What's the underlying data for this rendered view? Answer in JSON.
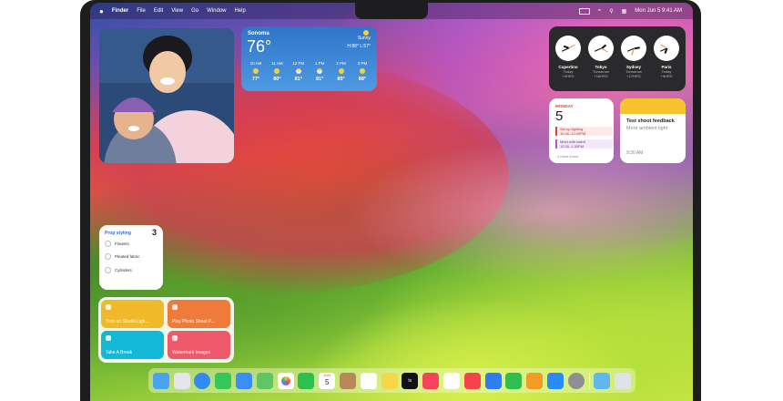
{
  "menubar": {
    "apple": "",
    "items": [
      "Finder",
      "File",
      "Edit",
      "View",
      "Go",
      "Window",
      "Help"
    ],
    "datetime": "Mon Jun 5  9:41 AM"
  },
  "weather": {
    "city": "Sonoma",
    "temp": "76°",
    "condition": "Sunny",
    "hilo": "H:88° L:57°",
    "hours": [
      {
        "time": "10 AM",
        "temp": "77°",
        "icon": "sun-icon"
      },
      {
        "time": "11 AM",
        "temp": "80°",
        "icon": "sun-icon"
      },
      {
        "time": "12 PM",
        "temp": "81°",
        "icon": "partly-cloudy-icon"
      },
      {
        "time": "1 PM",
        "temp": "81°",
        "icon": "partly-cloudy-icon"
      },
      {
        "time": "2 PM",
        "temp": "85°",
        "icon": "sun-icon"
      },
      {
        "time": "3 PM",
        "temp": "88°",
        "icon": "sun-icon"
      }
    ]
  },
  "clocks": [
    {
      "city": "Cupertino",
      "day": "Today",
      "offset": "+0HRS"
    },
    {
      "city": "Tokyo",
      "day": "Tomorrow",
      "offset": "+16HRS"
    },
    {
      "city": "Sydney",
      "day": "Tomorrow",
      "offset": "+17HRS"
    },
    {
      "city": "Paris",
      "day": "Today",
      "offset": "+9HRS"
    }
  ],
  "calendar": {
    "weekday": "MONDAY",
    "date": "5",
    "events": [
      {
        "title": "Set up lighting",
        "time": "10:30–12:00PM"
      },
      {
        "title": "Meet with talent",
        "time": "12:30–1:30PM"
      }
    ],
    "more": "1 more event"
  },
  "notes": {
    "title": "Test shoot feedback",
    "subtitle": "More ambient light",
    "time": "9:30 AM"
  },
  "reminders": {
    "title": "Prop styling",
    "count": "3",
    "items": [
      "Flowers",
      "Pleated fabric",
      "Cylinders"
    ]
  },
  "shortcuts": [
    {
      "label": "Turn on Studio Ligh...",
      "color": "#f0b929"
    },
    {
      "label": "Play Photo Shoot P...",
      "color": "#f07a3a"
    },
    {
      "label": "Take A Break",
      "color": "#12b8d6"
    },
    {
      "label": "Watermark Images",
      "color": "#ee5a6a"
    }
  ],
  "dock": [
    {
      "name": "finder-icon",
      "color": "#4aa3f0"
    },
    {
      "name": "launchpad-icon",
      "color": "#e6e6ea"
    },
    {
      "name": "safari-icon",
      "color": "#2f8bf0"
    },
    {
      "name": "messages-icon",
      "color": "#35c759"
    },
    {
      "name": "mail-icon",
      "color": "#3a8ef6"
    },
    {
      "name": "maps-icon",
      "color": "#5fc565"
    },
    {
      "name": "photos-icon",
      "color": "#f6c244"
    },
    {
      "name": "facetime-icon",
      "color": "#2fbf4f"
    },
    {
      "name": "calendar-icon",
      "color": "#ffffff"
    },
    {
      "name": "contacts-icon",
      "color": "#b8875a"
    },
    {
      "name": "reminders-icon",
      "color": "#ffffff"
    },
    {
      "name": "notes-icon",
      "color": "#f5d74a"
    },
    {
      "name": "tv-icon",
      "color": "#111111"
    },
    {
      "name": "music-icon",
      "color": "#f5435b"
    },
    {
      "name": "freeform-icon",
      "color": "#ffffff"
    },
    {
      "name": "news-icon",
      "color": "#f4434a"
    },
    {
      "name": "keynote-icon",
      "color": "#2f7df0"
    },
    {
      "name": "numbers-icon",
      "color": "#2fbf4f"
    },
    {
      "name": "pages-icon",
      "color": "#f49a27"
    },
    {
      "name": "app-store-icon",
      "color": "#2a8af6"
    },
    {
      "name": "system-settings-icon",
      "color": "#8e8e93"
    },
    {
      "name": "downloads-folder-icon",
      "color": "#5fb7ee"
    },
    {
      "name": "trash-icon",
      "color": "#dfe3e6"
    }
  ],
  "calendar_dock_date": "5",
  "calendar_dock_month": "JUN",
  "tv_label": "tv"
}
